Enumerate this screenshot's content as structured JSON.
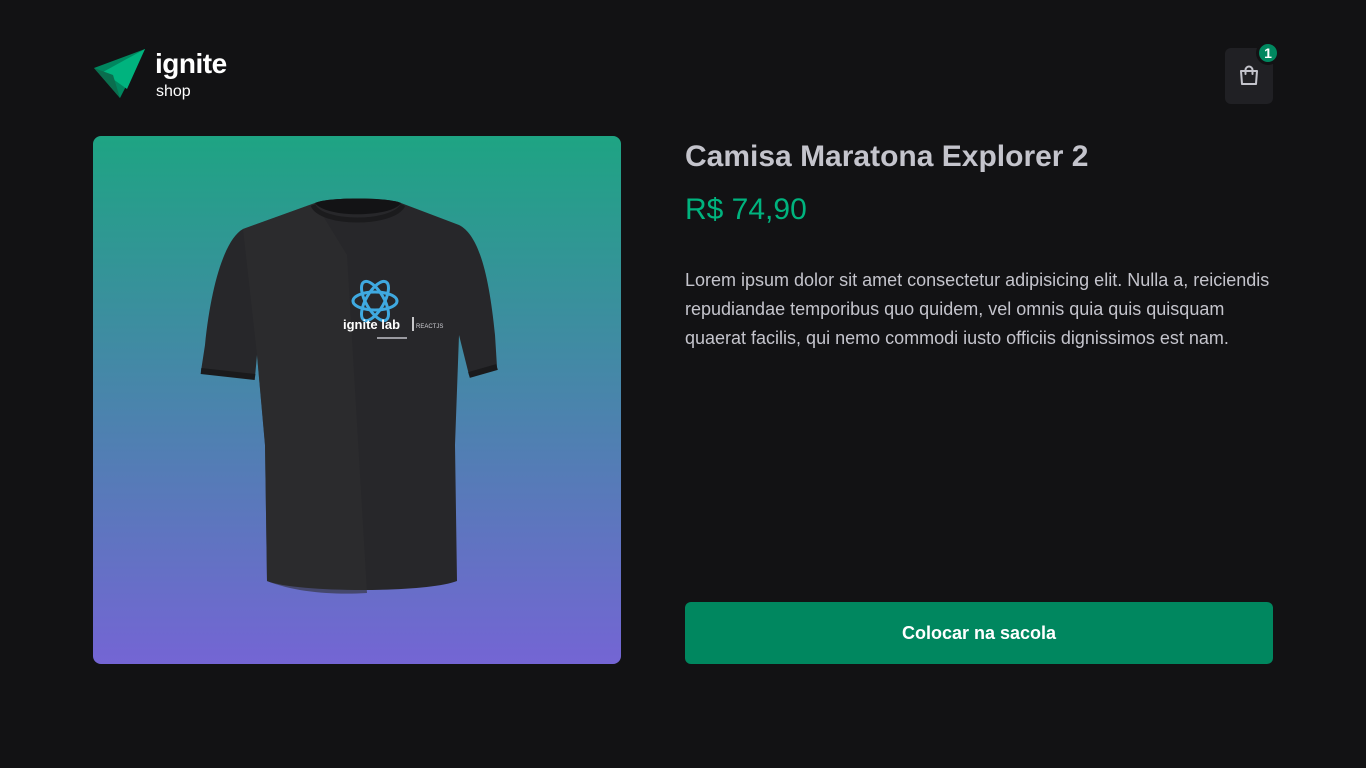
{
  "header": {
    "logo_title": "ignite",
    "logo_subtitle": "shop",
    "cart_count": "1"
  },
  "product": {
    "image_icon": "tshirt-image",
    "shirt_print_brand": "ignite lab",
    "shirt_print_tag": "REACTJS",
    "name": "Camisa Maratona Explorer 2",
    "price": "R$ 74,90",
    "description": "Lorem ipsum dolor sit amet consectetur adipisicing elit. Nulla a, reiciendis repudiandae temporibus quo quidem, vel omnis quia quis quisquam quaerat facilis, qui nemo commodi iusto officiis dignissimos est nam.",
    "buy_label": "Colocar na sacola"
  },
  "colors": {
    "background": "#121214",
    "accent": "#00875f",
    "price": "#00b37e",
    "gradient_top": "#1ea483",
    "gradient_bottom": "#7465d4"
  }
}
